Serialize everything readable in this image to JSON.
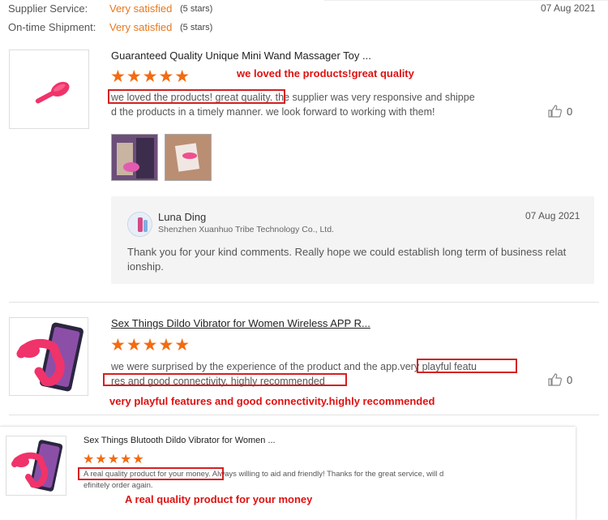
{
  "ratings": {
    "supplier_service": {
      "label": "Supplier Service:",
      "value": "Very satisfied",
      "stars": "(5 stars)"
    },
    "ontime_shipment": {
      "label": "On-time Shipment:",
      "value": "Very satisfied",
      "stars": "(5 stars)"
    },
    "date": "07 Aug 2021"
  },
  "reviews": [
    {
      "title": "Guaranteed Quality Unique Mini Wand Massager Toy ...",
      "stars": "★★★★★",
      "highlight": "we loved the products!great quality",
      "text_line1_boxed": "we loved the products! great quality.",
      "text_line1_rest": " the supplier was very responsive and shippe",
      "text_line2": "d the products in a timely manner. we look forward to working with them!",
      "likes": "0",
      "reply": {
        "name": "Luna Ding",
        "company": "Shenzhen Xuanhuo Tribe Technology Co., Ltd.",
        "date": "07 Aug 2021",
        "text_line1": "Thank you for your kind comments. Really hope we could establish long term of business relat",
        "text_line2": "ionship."
      }
    },
    {
      "title": "Sex Things Dildo Vibrator for Women Wireless APP R...",
      "stars": "★★★★★",
      "text_line1_plain": "we were surprised by the experience of the product and the app.",
      "text_line1_boxed": "very playful featu",
      "text_line2_boxed": "res and good connectivity. highly recommended",
      "highlight": "very playful features and good connectivity.highly recommended",
      "likes": "0"
    },
    {
      "title": "Sex Things Blutooth Dildo Vibrator for Women ...",
      "stars": "★★★★★",
      "text_line1_boxed": "A real quality product for your money.",
      "text_line1_rest": " Always willing to aid and friendly! Thanks for the great service, will d",
      "text_line2": "efinitely order again.",
      "highlight": "A real quality product for your money"
    }
  ],
  "colors": {
    "accent": "#f26b12",
    "annotation": "#e01010",
    "product_pink": "#f0336a"
  }
}
